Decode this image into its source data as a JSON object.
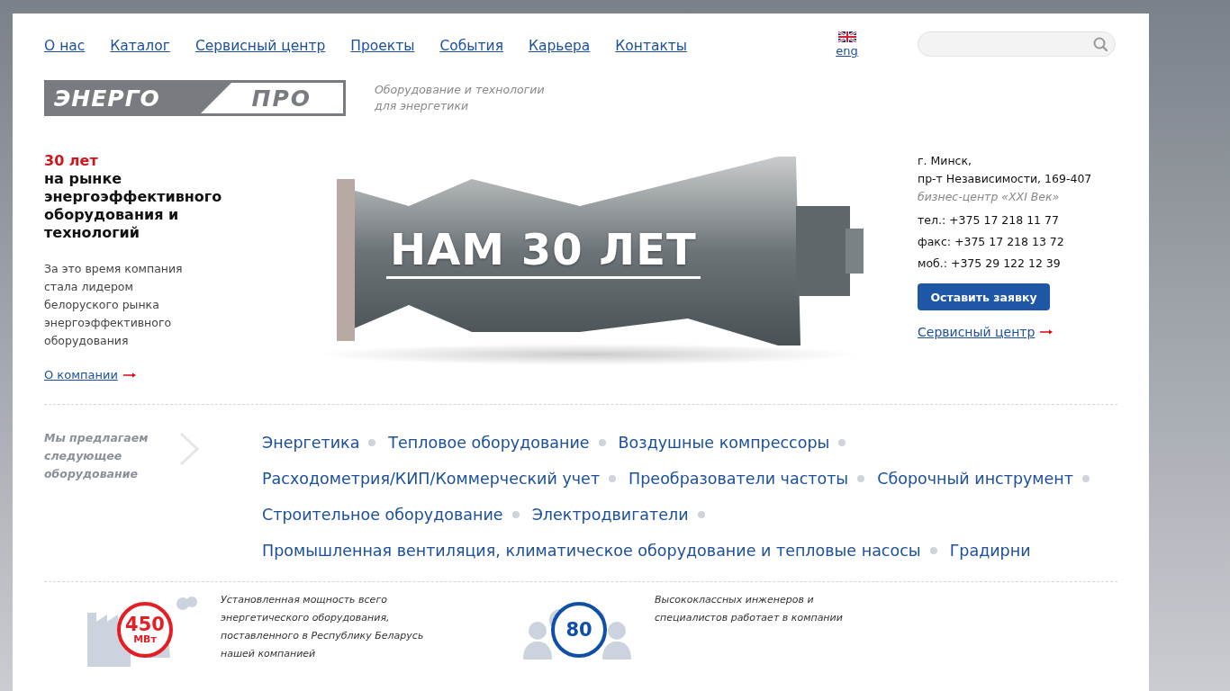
{
  "nav": [
    {
      "label": "О нас"
    },
    {
      "label": "Каталог"
    },
    {
      "label": "Сервисный центр"
    },
    {
      "label": "Проекты"
    },
    {
      "label": "События"
    },
    {
      "label": "Карьера"
    },
    {
      "label": "Контакты"
    }
  ],
  "language": {
    "label": "eng"
  },
  "logo": {
    "left": "ЭНЕРГО",
    "right": "ПРО"
  },
  "tagline": [
    "Оборудование и технологии",
    "для энергетики"
  ],
  "intro": {
    "highlight": "30 лет",
    "heading": "на рынке энергоэффективного оборудования и технологий",
    "text": "За это время компания стала лидером белоруского рынка энергоэффективного оборудования",
    "link": "О компании"
  },
  "hero": {
    "title": "НАМ 30 ЛЕТ"
  },
  "contacts": {
    "city": "г. Минск,",
    "address": "пр-т Независимости, 169-407",
    "building": "бизнес-центр «XXI Век»",
    "phones": [
      "тел.: +375 17 218 11 77",
      "факс: +375 17 218 13 72",
      "моб.: +375 29 122 12 39"
    ],
    "button": "Оставить заявку",
    "link": "Сервисный центр"
  },
  "offer": {
    "label": "Мы предлагаем следующее оборудование",
    "rows": [
      [
        "Энергетика",
        "Тепловое оборудование",
        "Воздушные компрессоры"
      ],
      [
        "Расходометрия/КИП/Коммерческий учет",
        "Преобразователи частоты",
        "Сборочный инструмент"
      ],
      [
        "Строительное оборудование",
        "Электродвигатели"
      ],
      [
        "Промышленная вентиляция, климатическое оборудование и тепловые насосы",
        "Градирни"
      ]
    ]
  },
  "stats": [
    {
      "kind": "factory",
      "color": "#e31e24",
      "value": "450",
      "unit": "МВт",
      "text": "Установленная мощность всего энергетического оборудования, поставленного в Республику Беларусь нашей компанией"
    },
    {
      "kind": "people",
      "color": "#0f4fa8",
      "value": "80",
      "text": "Высококлассных инженеров и специалистов работает в компании"
    }
  ]
}
